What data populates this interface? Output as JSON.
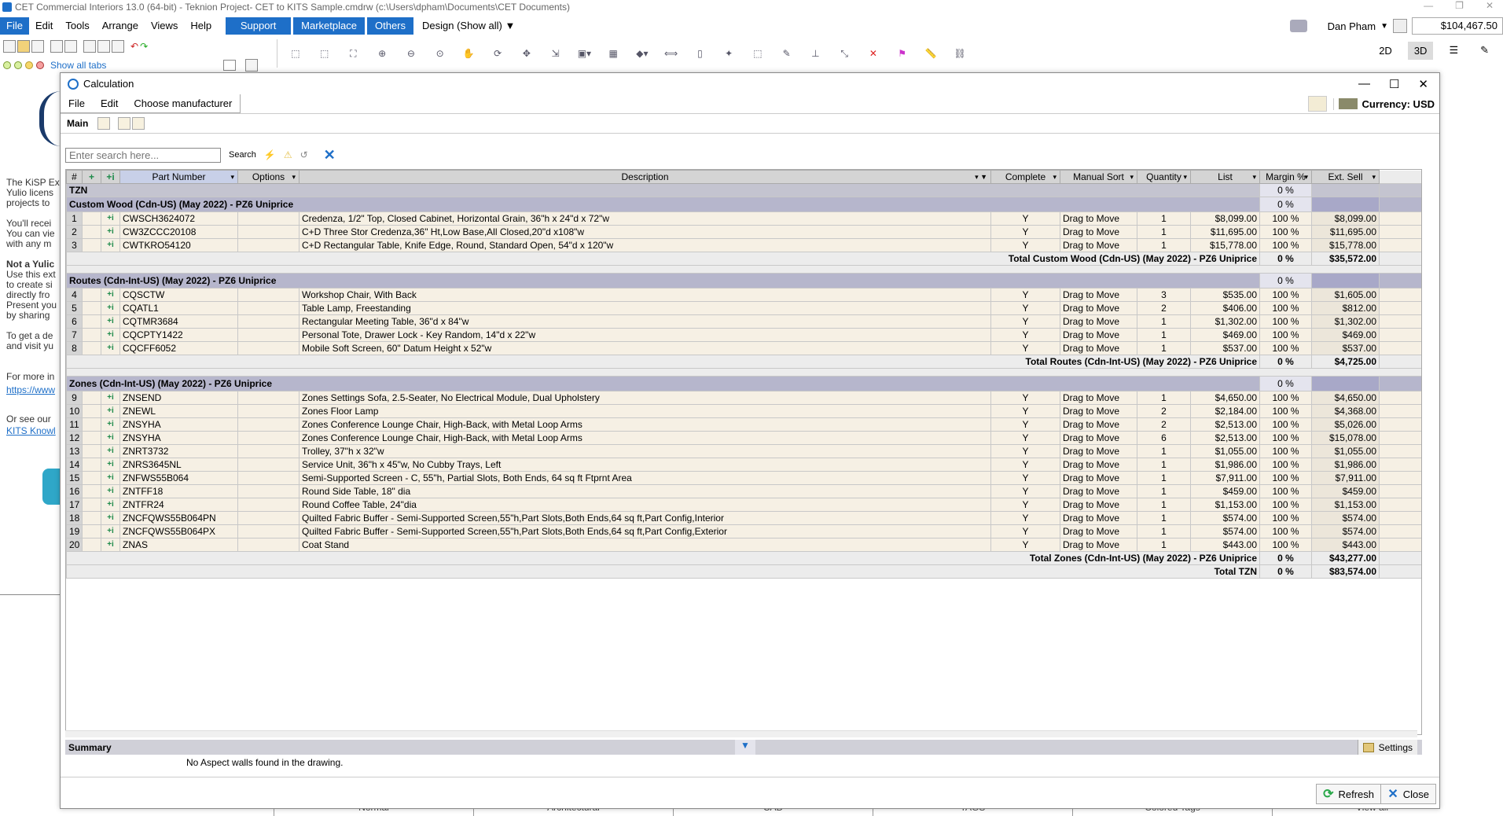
{
  "window": {
    "title": "CET Commercial Interiors 13.0 (64-bit) - Teknion Project- CET to KITS Sample.cmdrw (c:\\Users\\dpham\\Documents\\CET Documents)"
  },
  "menu": {
    "items": [
      "File",
      "Edit",
      "Tools",
      "Arrange",
      "Views",
      "Help"
    ],
    "blue_items": [
      "Support",
      "Marketplace",
      "Others"
    ],
    "design_label": "Design (Show all)"
  },
  "user": {
    "name": "Dan Pham",
    "balance": "$104,467.50"
  },
  "tabs_row": {
    "label": "Show all tabs"
  },
  "view_buttons": [
    "2D",
    "3D"
  ],
  "left_panel": {
    "lines": [
      "The KiSP Ex",
      "Yulio licens",
      "projects to",
      "",
      "You'll recei",
      "You can vie",
      "with any m",
      "",
      "Not a Yulic",
      "Use this ext",
      "to create si",
      "directly fro",
      "Present you",
      "by sharing",
      "",
      "To get a de",
      "and visit yu",
      "",
      "For more in",
      "https://www",
      "",
      "Or see our",
      "KITS Knowl"
    ]
  },
  "bottom_tabs": [
    "Normal",
    "Architectural",
    "CAD",
    "TAGS",
    "Colored Tags",
    "View all"
  ],
  "dialog": {
    "title": "Calculation",
    "menu": [
      "File",
      "Edit",
      "Choose manufacturer"
    ],
    "currency": "Currency: USD",
    "subtab": "Main",
    "search_placeholder": "Enter search here...",
    "search_label": "Search",
    "summary_title": "Summary",
    "summary_text": "No Aspect walls found in the drawing.",
    "settings_label": "Settings",
    "refresh_label": "Refresh",
    "close_label": "Close"
  },
  "grid": {
    "columns": [
      "#",
      "",
      "",
      "Part Number",
      "Options",
      "Description",
      "Complete",
      "Manual Sort",
      "Quantity",
      "List",
      "Margin %",
      "Ext. Sell"
    ],
    "tzn_label": "TZN",
    "tzn_margin": "0 %",
    "groups": [
      {
        "name": "Custom Wood (Cdn-US) (May 2022) - PZ6 Uniprice",
        "margin": "0 %",
        "rows": [
          {
            "n": "1",
            "part": "CWSCH3624072",
            "desc": "Credenza, 1/2\" Top, Closed Cabinet, Horizontal Grain, 36\"h x 24\"d x 72\"w",
            "complete": "Y",
            "sort": "Drag to Move",
            "qty": "1",
            "list": "$8,099.00",
            "margin": "100 %",
            "ext": "$8,099.00"
          },
          {
            "n": "2",
            "part": "CW3ZCCC20108",
            "desc": "C+D Three Stor Credenza,36\" Ht,Low Base,All Closed,20\"d x108\"w",
            "complete": "Y",
            "sort": "Drag to Move",
            "qty": "1",
            "list": "$11,695.00",
            "margin": "100 %",
            "ext": "$11,695.00"
          },
          {
            "n": "3",
            "part": "CWTKRO54120",
            "desc": "C+D Rectangular Table, Knife Edge, Round, Standard Open, 54\"d x 120\"w",
            "complete": "Y",
            "sort": "Drag to Move",
            "qty": "1",
            "list": "$15,778.00",
            "margin": "100 %",
            "ext": "$15,778.00"
          }
        ],
        "total_label": "Total Custom Wood (Cdn-US) (May 2022) - PZ6 Uniprice",
        "total_margin": "0 %",
        "total": "$35,572.00"
      },
      {
        "name": "Routes (Cdn-Int-US) (May 2022) - PZ6 Uniprice",
        "margin": "0 %",
        "rows": [
          {
            "n": "4",
            "part": "CQSCTW",
            "desc": "Workshop Chair, With Back",
            "complete": "Y",
            "sort": "Drag to Move",
            "qty": "3",
            "list": "$535.00",
            "margin": "100 %",
            "ext": "$1,605.00"
          },
          {
            "n": "5",
            "part": "CQATL1",
            "desc": "Table Lamp, Freestanding",
            "complete": "Y",
            "sort": "Drag to Move",
            "qty": "2",
            "list": "$406.00",
            "margin": "100 %",
            "ext": "$812.00"
          },
          {
            "n": "6",
            "part": "CQTMR3684",
            "desc": "Rectangular Meeting Table, 36\"d x 84\"w",
            "complete": "Y",
            "sort": "Drag to Move",
            "qty": "1",
            "list": "$1,302.00",
            "margin": "100 %",
            "ext": "$1,302.00"
          },
          {
            "n": "7",
            "part": "CQCPTY1422",
            "desc": "Personal Tote, Drawer Lock - Key Random, 14\"d x 22\"w",
            "complete": "Y",
            "sort": "Drag to Move",
            "qty": "1",
            "list": "$469.00",
            "margin": "100 %",
            "ext": "$469.00"
          },
          {
            "n": "8",
            "part": "CQCFF6052",
            "desc": "Mobile Soft Screen, 60\" Datum Height x 52\"w",
            "complete": "Y",
            "sort": "Drag to Move",
            "qty": "1",
            "list": "$537.00",
            "margin": "100 %",
            "ext": "$537.00"
          }
        ],
        "total_label": "Total Routes (Cdn-Int-US) (May 2022) - PZ6 Uniprice",
        "total_margin": "0 %",
        "total": "$4,725.00"
      },
      {
        "name": "Zones (Cdn-Int-US) (May 2022) - PZ6 Uniprice",
        "margin": "0 %",
        "rows": [
          {
            "n": "9",
            "part": "ZNSEND",
            "desc": "Zones Settings Sofa, 2.5-Seater, No Electrical Module, Dual Upholstery",
            "complete": "Y",
            "sort": "Drag to Move",
            "qty": "1",
            "list": "$4,650.00",
            "margin": "100 %",
            "ext": "$4,650.00"
          },
          {
            "n": "10",
            "part": "ZNEWL",
            "desc": "Zones Floor Lamp",
            "complete": "Y",
            "sort": "Drag to Move",
            "qty": "2",
            "list": "$2,184.00",
            "margin": "100 %",
            "ext": "$4,368.00"
          },
          {
            "n": "11",
            "part": "ZNSYHA",
            "desc": "Zones Conference Lounge Chair, High-Back, with Metal Loop Arms",
            "complete": "Y",
            "sort": "Drag to Move",
            "qty": "2",
            "list": "$2,513.00",
            "margin": "100 %",
            "ext": "$5,026.00"
          },
          {
            "n": "12",
            "part": "ZNSYHA",
            "desc": "Zones Conference Lounge Chair, High-Back, with Metal Loop Arms",
            "complete": "Y",
            "sort": "Drag to Move",
            "qty": "6",
            "list": "$2,513.00",
            "margin": "100 %",
            "ext": "$15,078.00"
          },
          {
            "n": "13",
            "part": "ZNRT3732",
            "desc": "Trolley, 37\"h x 32\"w",
            "complete": "Y",
            "sort": "Drag to Move",
            "qty": "1",
            "list": "$1,055.00",
            "margin": "100 %",
            "ext": "$1,055.00"
          },
          {
            "n": "14",
            "part": "ZNRS3645NL",
            "desc": "Service Unit, 36\"h x 45\"w, No Cubby Trays, Left",
            "complete": "Y",
            "sort": "Drag to Move",
            "qty": "1",
            "list": "$1,986.00",
            "margin": "100 %",
            "ext": "$1,986.00"
          },
          {
            "n": "15",
            "part": "ZNFWS55B064",
            "desc": "Semi-Supported Screen - C, 55\"h, Partial Slots, Both Ends, 64 sq ft Ftprnt Area",
            "complete": "Y",
            "sort": "Drag to Move",
            "qty": "1",
            "list": "$7,911.00",
            "margin": "100 %",
            "ext": "$7,911.00"
          },
          {
            "n": "16",
            "part": "ZNTFF18",
            "desc": "Round Side Table, 18\" dia",
            "complete": "Y",
            "sort": "Drag to Move",
            "qty": "1",
            "list": "$459.00",
            "margin": "100 %",
            "ext": "$459.00"
          },
          {
            "n": "17",
            "part": "ZNTFR24",
            "desc": "Round Coffee Table, 24\"dia",
            "complete": "Y",
            "sort": "Drag to Move",
            "qty": "1",
            "list": "$1,153.00",
            "margin": "100 %",
            "ext": "$1,153.00"
          },
          {
            "n": "18",
            "part": "ZNCFQWS55B064PN",
            "desc": "Quilted Fabric Buffer - Semi-Supported Screen,55\"h,Part Slots,Both Ends,64 sq ft,Part Config,Interior",
            "complete": "Y",
            "sort": "Drag to Move",
            "qty": "1",
            "list": "$574.00",
            "margin": "100 %",
            "ext": "$574.00"
          },
          {
            "n": "19",
            "part": "ZNCFQWS55B064PX",
            "desc": "Quilted Fabric Buffer - Semi-Supported Screen,55\"h,Part Slots,Both Ends,64 sq ft,Part Config,Exterior",
            "complete": "Y",
            "sort": "Drag to Move",
            "qty": "1",
            "list": "$574.00",
            "margin": "100 %",
            "ext": "$574.00"
          },
          {
            "n": "20",
            "part": "ZNAS",
            "desc": "Coat Stand",
            "complete": "Y",
            "sort": "Drag to Move",
            "qty": "1",
            "list": "$443.00",
            "margin": "100 %",
            "ext": "$443.00"
          }
        ],
        "total_label": "Total Zones (Cdn-Int-US) (May 2022) - PZ6 Uniprice",
        "total_margin": "0 %",
        "total": "$43,277.00"
      }
    ],
    "grand_total_label": "Total TZN",
    "grand_total_margin": "0 %",
    "grand_total": "$83,574.00"
  },
  "colors": {
    "accent": "#1e6fc8",
    "group_header": "#b6b6cc",
    "row_bg": "#f6f0e4"
  }
}
